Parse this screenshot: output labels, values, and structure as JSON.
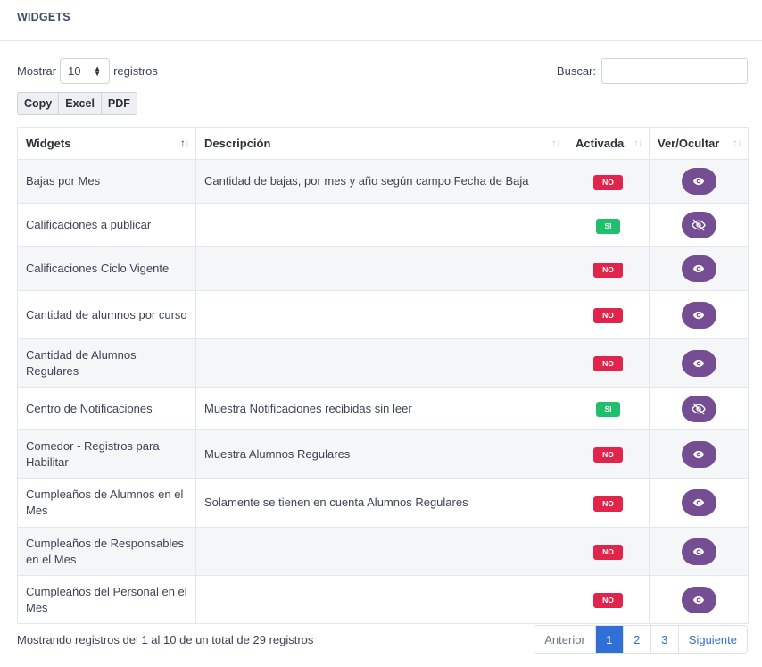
{
  "header": {
    "title": "WIDGETS"
  },
  "length": {
    "prefix": "Mostrar",
    "value": "10",
    "suffix": "registros"
  },
  "search": {
    "label": "Buscar:",
    "value": ""
  },
  "export_buttons": [
    "Copy",
    "Excel",
    "PDF"
  ],
  "table": {
    "columns": [
      "Widgets",
      "Descripción",
      "Activada",
      "Ver/Ocultar"
    ],
    "rows": [
      {
        "widget": "Bajas por Mes",
        "descripcion": "Cantidad de bajas, por mes y año según campo Fecha de Baja",
        "activada": "NO",
        "visible": true
      },
      {
        "widget": "Calificaciones a publicar",
        "descripcion": "",
        "activada": "SI",
        "visible": false
      },
      {
        "widget": "Calificaciones Ciclo Vigente",
        "descripcion": "",
        "activada": "NO",
        "visible": true
      },
      {
        "widget": "Cantidad de alumnos por curso",
        "descripcion": "",
        "activada": "NO",
        "visible": true
      },
      {
        "widget": "Cantidad de Alumnos Regulares",
        "descripcion": "",
        "activada": "NO",
        "visible": true
      },
      {
        "widget": "Centro de Notificaciones",
        "descripcion": "Muestra Notificaciones recibidas sin leer",
        "activada": "SI",
        "visible": false
      },
      {
        "widget": "Comedor - Registros para Habilitar",
        "descripcion": "Muestra Alumnos Regulares",
        "activada": "NO",
        "visible": true
      },
      {
        "widget": "Cumpleaños de Alumnos en el Mes",
        "descripcion": "Solamente se tienen en cuenta Alumnos Regulares",
        "activada": "NO",
        "visible": true
      },
      {
        "widget": "Cumpleaños de Responsables en el Mes",
        "descripcion": "",
        "activada": "NO",
        "visible": true
      },
      {
        "widget": "Cumpleaños del Personal en el Mes",
        "descripcion": "",
        "activada": "NO",
        "visible": true
      }
    ]
  },
  "footer": {
    "info": "Mostrando registros del 1 al 10 de un total de 29 registros"
  },
  "pagination": {
    "previous": "Anterior",
    "pages": [
      "1",
      "2",
      "3"
    ],
    "current": "1",
    "next": "Siguiente"
  },
  "colors": {
    "no_badge": "#e1244c",
    "si_badge": "#1fbf6b",
    "eye_button": "#744d93",
    "page_active": "#2f6fd6"
  },
  "icons": {
    "visible": "eye-icon",
    "hidden": "eye-slash-icon"
  }
}
